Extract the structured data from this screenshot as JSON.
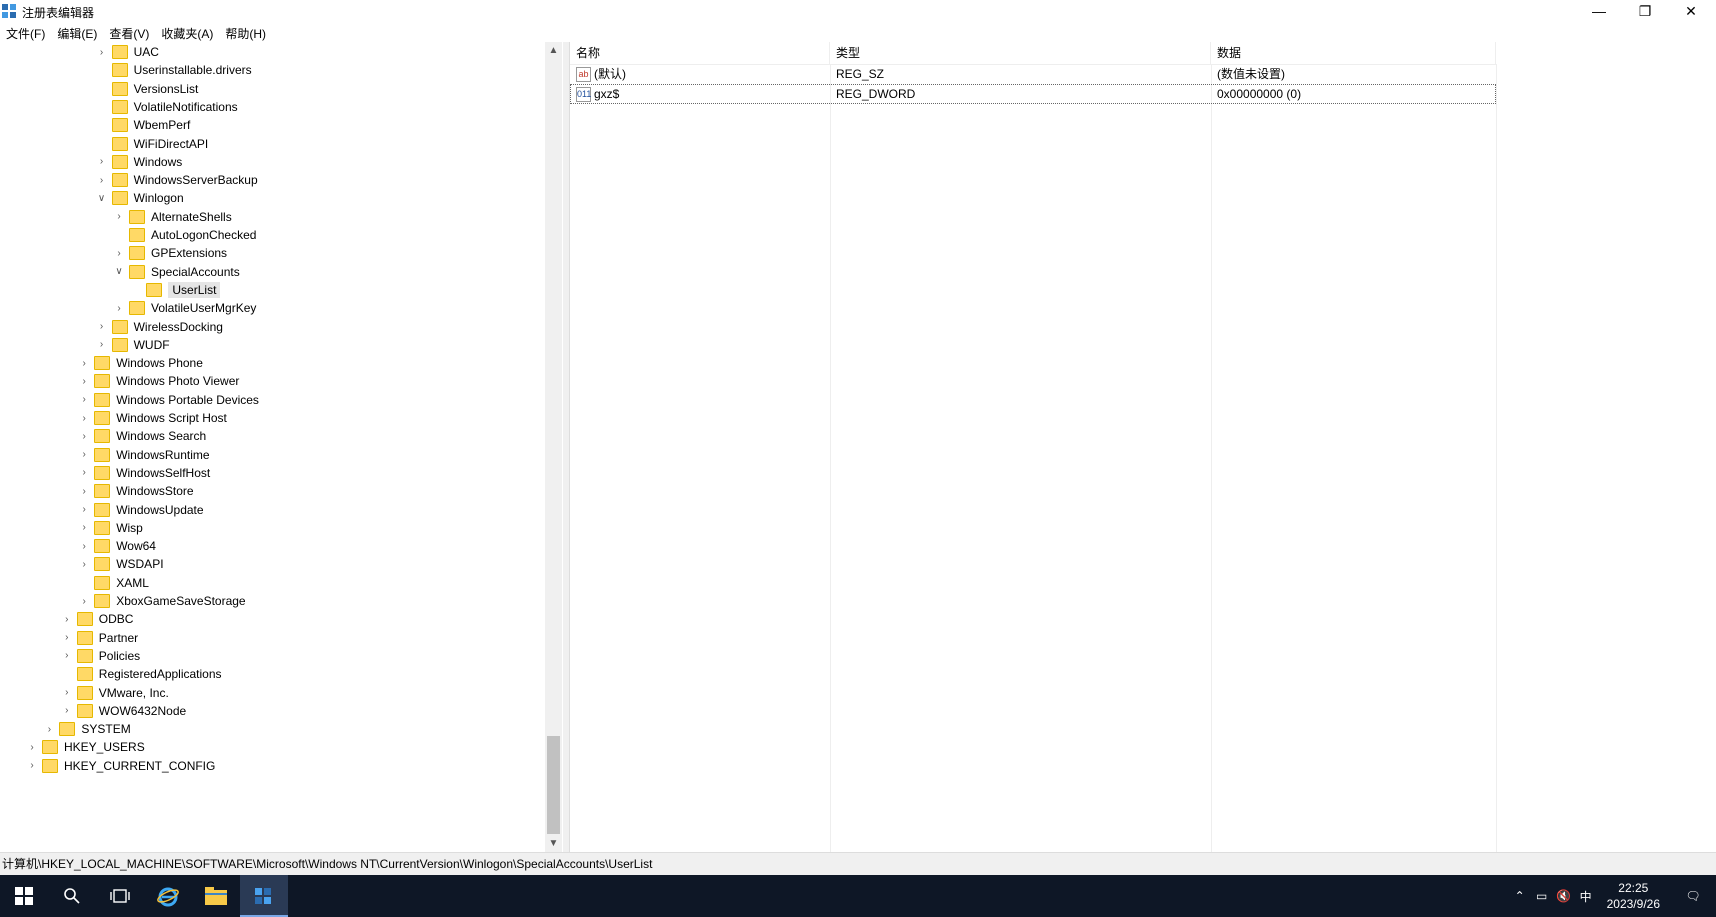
{
  "window": {
    "title": "注册表编辑器"
  },
  "menu": [
    "文件(F)",
    "编辑(E)",
    "查看(V)",
    "收藏夹(A)",
    "帮助(H)"
  ],
  "tree": [
    {
      "label": "UAC",
      "level": 4,
      "exp": ">"
    },
    {
      "label": "Userinstallable.drivers",
      "level": 4,
      "exp": ""
    },
    {
      "label": "VersionsList",
      "level": 4,
      "exp": ""
    },
    {
      "label": "VolatileNotifications",
      "level": 4,
      "exp": ""
    },
    {
      "label": "WbemPerf",
      "level": 4,
      "exp": ""
    },
    {
      "label": "WiFiDirectAPI",
      "level": 4,
      "exp": ""
    },
    {
      "label": "Windows",
      "level": 4,
      "exp": ">"
    },
    {
      "label": "WindowsServerBackup",
      "level": 4,
      "exp": ">"
    },
    {
      "label": "Winlogon",
      "level": 4,
      "exp": "v"
    },
    {
      "label": "AlternateShells",
      "level": 5,
      "exp": ">"
    },
    {
      "label": "AutoLogonChecked",
      "level": 5,
      "exp": ""
    },
    {
      "label": "GPExtensions",
      "level": 5,
      "exp": ">"
    },
    {
      "label": "SpecialAccounts",
      "level": 5,
      "exp": "v"
    },
    {
      "label": "UserList",
      "level": 6,
      "exp": "",
      "selected": true
    },
    {
      "label": "VolatileUserMgrKey",
      "level": 5,
      "exp": ">"
    },
    {
      "label": "WirelessDocking",
      "level": 4,
      "exp": ">"
    },
    {
      "label": "WUDF",
      "level": 4,
      "exp": ">"
    },
    {
      "label": "Windows Phone",
      "level": 3,
      "exp": ">"
    },
    {
      "label": "Windows Photo Viewer",
      "level": 3,
      "exp": ">"
    },
    {
      "label": "Windows Portable Devices",
      "level": 3,
      "exp": ">"
    },
    {
      "label": "Windows Script Host",
      "level": 3,
      "exp": ">"
    },
    {
      "label": "Windows Search",
      "level": 3,
      "exp": ">"
    },
    {
      "label": "WindowsRuntime",
      "level": 3,
      "exp": ">"
    },
    {
      "label": "WindowsSelfHost",
      "level": 3,
      "exp": ">"
    },
    {
      "label": "WindowsStore",
      "level": 3,
      "exp": ">"
    },
    {
      "label": "WindowsUpdate",
      "level": 3,
      "exp": ">"
    },
    {
      "label": "Wisp",
      "level": 3,
      "exp": ">"
    },
    {
      "label": "Wow64",
      "level": 3,
      "exp": ">"
    },
    {
      "label": "WSDAPI",
      "level": 3,
      "exp": ">"
    },
    {
      "label": "XAML",
      "level": 3,
      "exp": ""
    },
    {
      "label": "XboxGameSaveStorage",
      "level": 3,
      "exp": ">"
    },
    {
      "label": "ODBC",
      "level": 2,
      "exp": ">"
    },
    {
      "label": "Partner",
      "level": 2,
      "exp": ">"
    },
    {
      "label": "Policies",
      "level": 2,
      "exp": ">"
    },
    {
      "label": "RegisteredApplications",
      "level": 2,
      "exp": ""
    },
    {
      "label": "VMware, Inc.",
      "level": 2,
      "exp": ">"
    },
    {
      "label": "WOW6432Node",
      "level": 2,
      "exp": ">"
    },
    {
      "label": "SYSTEM",
      "level": 1,
      "exp": ">"
    },
    {
      "label": "HKEY_USERS",
      "level": 0,
      "exp": ">"
    },
    {
      "label": "HKEY_CURRENT_CONFIG",
      "level": 0,
      "exp": ">"
    }
  ],
  "values": {
    "headers": {
      "name": "名称",
      "type": "类型",
      "data": "数据"
    },
    "rows": [
      {
        "icon": "ab",
        "name": "(默认)",
        "type": "REG_SZ",
        "data": "(数值未设置)"
      },
      {
        "icon": "011",
        "name": "gxz$",
        "type": "REG_DWORD",
        "data": "0x00000000 (0)",
        "selected": true
      }
    ]
  },
  "status": {
    "path": "计算机\\HKEY_LOCAL_MACHINE\\SOFTWARE\\Microsoft\\Windows NT\\CurrentVersion\\Winlogon\\SpecialAccounts\\UserList"
  },
  "taskbar": {
    "apps": [
      "start-icon",
      "search-icon",
      "task-view-icon",
      "ie-icon",
      "file-explorer-icon",
      "regedit-icon"
    ],
    "tray": {
      "ime": "中",
      "time": "22:25",
      "date": "2023/9/26"
    }
  }
}
